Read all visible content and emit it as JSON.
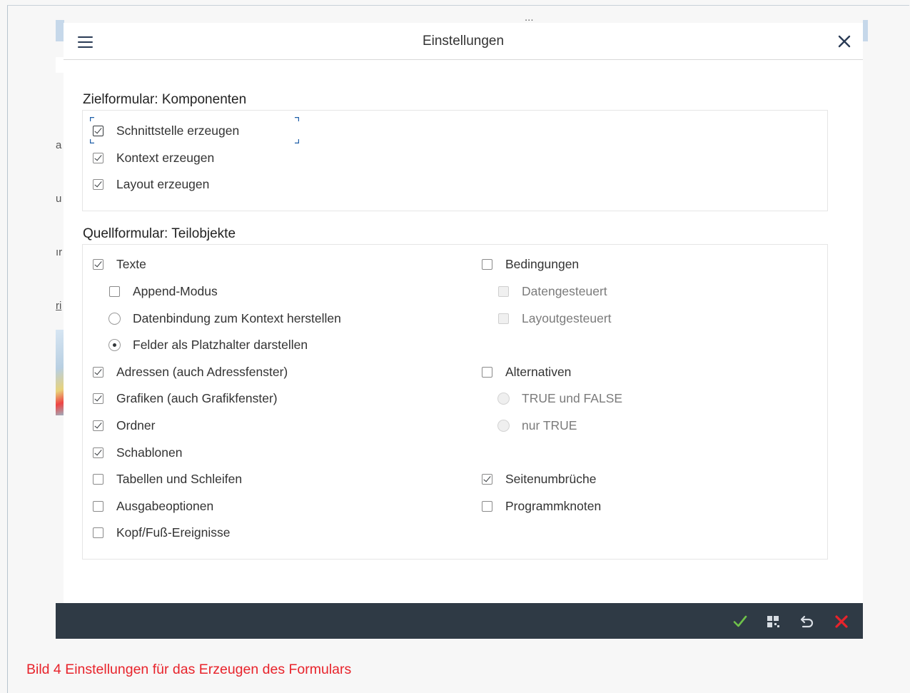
{
  "dialog": {
    "title": "Einstellungen",
    "menu_icon": "hamburger-menu-icon",
    "close_icon": "close-icon"
  },
  "background": {
    "behind_title_fragment": "...",
    "glyphs": [
      "a",
      "u",
      "ır",
      "ri"
    ]
  },
  "target_section": {
    "title": "Zielformular: Komponenten",
    "options": [
      {
        "label": "Schnittstelle erzeugen",
        "checked": true,
        "focused": true
      },
      {
        "label": "Kontext erzeugen",
        "checked": true
      },
      {
        "label": "Layout erzeugen",
        "checked": true
      }
    ]
  },
  "source_section": {
    "title": "Quellformular: Teilobjekte",
    "left": [
      {
        "label": "Texte",
        "type": "checkbox",
        "checked": true
      },
      {
        "label": "Append-Modus",
        "type": "checkbox",
        "checked": false,
        "indent": true
      },
      {
        "label": "Datenbindung zum Kontext herstellen",
        "type": "radio",
        "checked": false,
        "indent": true
      },
      {
        "label": "Felder als Platzhalter darstellen",
        "type": "radio",
        "checked": true,
        "indent": true
      },
      {
        "label": "Adressen (auch Adressfenster)",
        "type": "checkbox",
        "checked": true
      },
      {
        "label": "Grafiken (auch Grafikfenster)",
        "type": "checkbox",
        "checked": true
      },
      {
        "label": "Ordner",
        "type": "checkbox",
        "checked": true
      },
      {
        "label": "Schablonen",
        "type": "checkbox",
        "checked": true
      },
      {
        "label": "Tabellen und Schleifen",
        "type": "checkbox",
        "checked": false
      },
      {
        "label": "Ausgabeoptionen",
        "type": "checkbox",
        "checked": false
      },
      {
        "label": "Kopf/Fuß-Ereignisse",
        "type": "checkbox",
        "checked": false
      }
    ],
    "right": [
      {
        "label": "Bedingungen",
        "type": "checkbox",
        "checked": false
      },
      {
        "label": "Datengesteuert",
        "type": "checkbox",
        "checked": false,
        "disabled": true
      },
      {
        "label": "Layoutgesteuert",
        "type": "checkbox",
        "checked": false,
        "disabled": true
      },
      {
        "label": "Alternativen",
        "type": "checkbox",
        "checked": false
      },
      {
        "label": "TRUE und FALSE",
        "type": "radio",
        "checked": false,
        "disabled": true
      },
      {
        "label": "nur TRUE",
        "type": "radio",
        "checked": false,
        "disabled": true
      },
      {
        "label": "Seitenumbrüche",
        "type": "checkbox",
        "checked": true
      },
      {
        "label": "Programmknoten",
        "type": "checkbox",
        "checked": false
      }
    ]
  },
  "footer": {
    "buttons": [
      {
        "icon": "confirm-check-icon",
        "color": "#6fc24a"
      },
      {
        "icon": "grid-select-icon",
        "color": "#d8dde3"
      },
      {
        "icon": "undo-icon",
        "color": "#d8dde3"
      },
      {
        "icon": "cancel-x-icon",
        "color": "#e8232b"
      }
    ]
  },
  "caption": "Bild 4 Einstellungen für das Erzeugen des Formulars",
  "colors": {
    "footer_bg": "#2f3a45",
    "caption": "#e8232b",
    "accent_blue": "#c6d8ea"
  }
}
